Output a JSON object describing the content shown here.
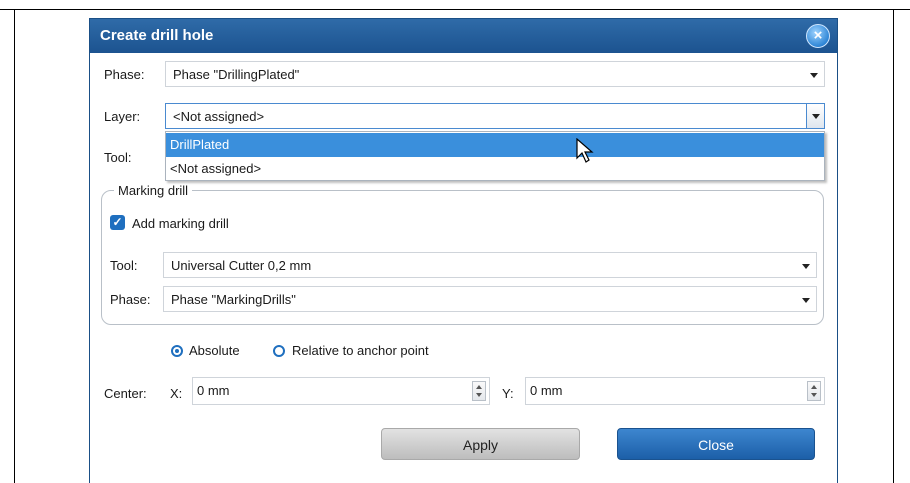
{
  "dialog": {
    "title": "Create drill hole"
  },
  "phase": {
    "label": "Phase:",
    "value": "Phase \"DrillingPlated\""
  },
  "layer": {
    "label": "Layer:",
    "value": "<Not assigned>",
    "options": [
      "DrillPlated",
      "<Not assigned>"
    ],
    "highlighted": "DrillPlated"
  },
  "tool": {
    "label": "Tool:"
  },
  "marking": {
    "legend": "Marking drill",
    "checkbox_label": "Add marking drill",
    "checked": true,
    "tool_label": "Tool:",
    "tool_value": "Universal Cutter 0,2 mm",
    "phase_label": "Phase:",
    "phase_value": "Phase \"MarkingDrills\""
  },
  "mode": {
    "absolute": "Absolute",
    "relative": "Relative to anchor point",
    "selected": "Absolute"
  },
  "center": {
    "label": "Center:",
    "x_label": "X:",
    "x_value": "0 mm",
    "y_label": "Y:",
    "y_value": "0 mm"
  },
  "buttons": {
    "apply": "Apply",
    "close": "Close"
  },
  "colors": {
    "titlebar": "#1c5390",
    "accent": "#1f6fbf",
    "selection": "#3a8fdc"
  }
}
